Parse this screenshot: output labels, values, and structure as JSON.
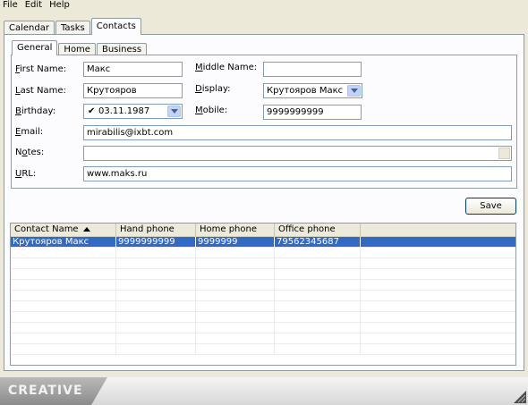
{
  "menu": {
    "file": "File",
    "edit": "Edit",
    "help": "Help"
  },
  "outer_tabs": {
    "calendar": "Calendar",
    "tasks": "Tasks",
    "contacts": "Contacts"
  },
  "inner_tabs": {
    "general": "General",
    "home": "Home",
    "business": "Business"
  },
  "form": {
    "first_name_label_u": "F",
    "first_name_label_rest": "irst Name:",
    "first_name_value": "Макс",
    "middle_name_label_u": "M",
    "middle_name_label_rest": "iddle Name:",
    "middle_name_value": "",
    "last_name_label_u": "L",
    "last_name_label_rest": "ast Name:",
    "last_name_value": "Крутояров",
    "display_label_u": "D",
    "display_label_rest": "isplay:",
    "display_value": "Крутояров Макс",
    "birthday_label_u": "B",
    "birthday_label_rest": "irthday:",
    "birthday_check": "✔",
    "birthday_value": "03.11.1987",
    "mobile_label_u": "M",
    "mobile_label_rest": "obile:",
    "mobile_value": "9999999999",
    "email_label_u": "E",
    "email_label_rest": "mail:",
    "email_value": "mirabilis@ixbt.com",
    "notes_label_pre": "N",
    "notes_label_u": "o",
    "notes_label_rest": "tes:",
    "notes_value": "",
    "url_label_u": "U",
    "url_label_rest": "RL:",
    "url_value": "www.maks.ru"
  },
  "save_label": "Save",
  "grid": {
    "headers": [
      "Contact Name",
      "Hand phone",
      "Home phone",
      "Office phone",
      ""
    ],
    "rows": [
      [
        "Крутояров Макс",
        "9999999999",
        "9999999",
        "79562345687",
        ""
      ]
    ]
  },
  "footer": {
    "logo": "CREATIVE"
  },
  "colors": {
    "selection": "#316ac5",
    "background": "#ece9d8",
    "border": "#919b9c"
  }
}
